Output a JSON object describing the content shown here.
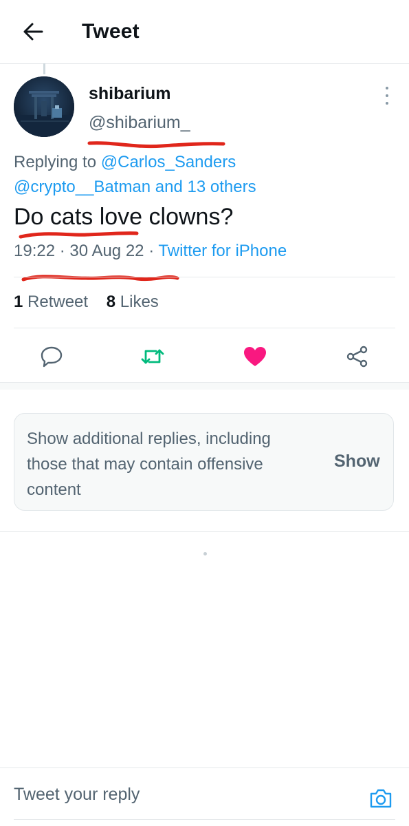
{
  "header": {
    "title": "Tweet",
    "back_icon": "arrow-left-icon"
  },
  "tweet": {
    "display_name": "shibarium",
    "handle": "@shibarium_",
    "replying_prefix": "Replying to",
    "replying_to_primary": "@Carlos_Sanders",
    "replying_to_secondary": "@crypto__Batman and 13 others",
    "text": "Do cats love clowns?",
    "time": "19:22",
    "separator": "·",
    "date": "30 Aug 22",
    "source": "Twitter for iPhone",
    "retweets_count": "1",
    "retweets_label": "Retweet",
    "likes_count": "8",
    "likes_label": "Likes",
    "liked": true
  },
  "actions": {
    "reply_icon": "reply-icon",
    "retweet_icon": "retweet-icon",
    "like_icon": "heart-icon",
    "share_icon": "share-icon"
  },
  "offensive_notice": {
    "text": "Show additional replies, including those that may contain offensive content",
    "button_label": "Show"
  },
  "composer": {
    "placeholder": "Tweet your reply",
    "camera_icon": "camera-icon"
  },
  "colors": {
    "link": "#1d9bf0",
    "retweet": "#00ba7c",
    "like": "#f91880",
    "secondary_text": "#536471",
    "annotation_marks": "#e0261b"
  }
}
